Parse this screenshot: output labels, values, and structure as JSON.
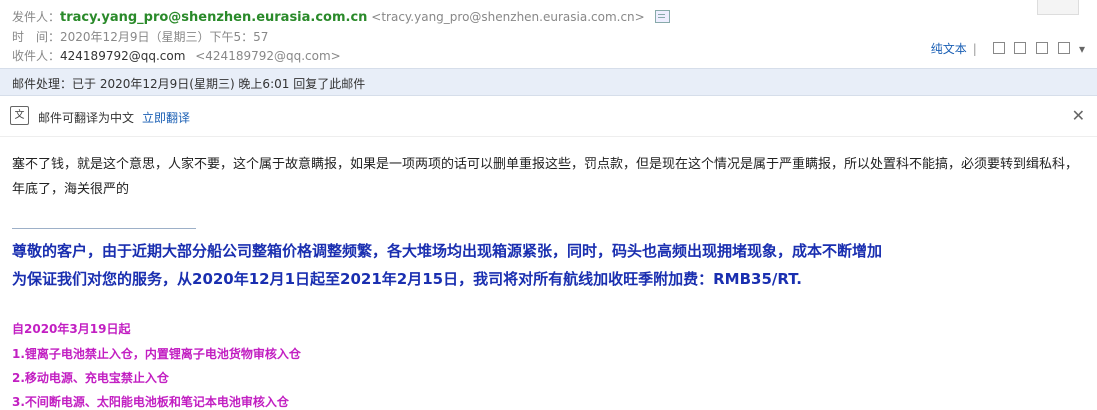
{
  "header": {
    "from_label": "发件人：",
    "from_name": "tracy.yang_pro@shenzhen.eurasia.com.cn",
    "from_addr": "<tracy.yang_pro@shenzhen.eurasia.com.cn>",
    "time_label": "时　间：",
    "time_value": "2020年12月9日（星期三）下午5：57",
    "to_label": "收件人：",
    "to_name": "424189792@qq.com",
    "to_addr": "<424189792@qq.com>",
    "plain_text_label": "纯文本",
    "tool_sep": "|",
    "more_icon": "▾"
  },
  "process_bar": {
    "text": "邮件处理：已于 2020年12月9日(星期三) 晚上6:01 回复了此邮件"
  },
  "translate_bar": {
    "icon_text": "文",
    "text": "邮件可翻译为中文",
    "link": "立即翻译",
    "close": "✕"
  },
  "body": {
    "paragraph": "塞不了钱，就是这个意思，人家不要，这个属于故意瞒报，如果是一项两项的话可以删单重报这些，罚点款，但是现在这个情况是属于严重瞒报，所以处置科不能搞，必须要转到缉私科，年底了，海关很严的",
    "notice_line1": "尊敬的客户，由于近期大部分船公司整箱价格调整频繁，各大堆场均出现箱源紧张，同时，码头也高频出现拥堵现象，成本不断增加",
    "notice_line2": "为保证我们对您的服务，从2020年12月1日起至2021年2月15日，我司将对所有航线加收旺季附加费：RMB35/RT.",
    "pink_lines": [
      "自2020年3月19日起",
      "1.锂离子电池禁止入仓，内置锂离子电池货物审核入仓",
      "2.移动电源、充电宝禁止入仓",
      "3.不间断电源、太阳能电池板和笔记本电池审核入仓"
    ]
  }
}
